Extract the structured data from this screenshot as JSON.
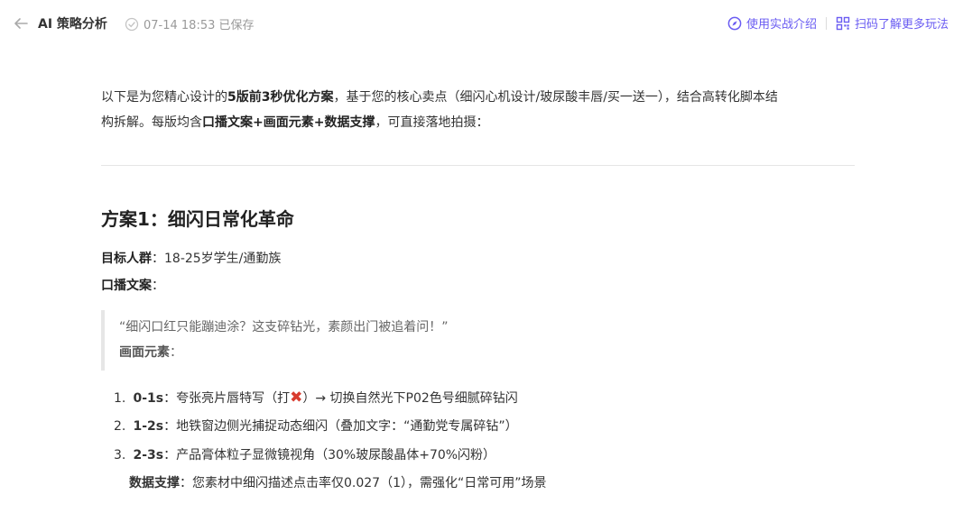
{
  "header": {
    "title": "AI 策略分析",
    "save_status": "07-14 18:53 已保存",
    "link_intro": "使用实战介绍",
    "link_scan": "扫码了解更多玩法",
    "accent_color": "#6a5cf2"
  },
  "intro": {
    "p1_a": "以下是为您精心设计的",
    "p1_b": "5版前3秒优化方案",
    "p1_c": "，基于您的核心卖点（细闪心机设计/玻尿酸丰唇/买一送一），结合高转化脚本结",
    "p2_a": "构拆解。每版均含",
    "p2_b": "口播文案+画面元素+数据支撑",
    "p2_c": "，可直接落地拍摄："
  },
  "plan1": {
    "heading": "方案1：细闪日常化革命",
    "audience_label": "目标人群",
    "audience_value": "：18-25岁学生/通勤族",
    "script_label": "口播文案",
    "script_colon": "：",
    "quote_text": "“细闪口红只能蹦迪涂？这支碎钻光，素颜出门被追着问！”",
    "elements_label": "画面元素",
    "elements_colon": "：",
    "steps": [
      {
        "num": "1.",
        "time": "0-1s",
        "text_a": "：夸张亮片唇特写（打",
        "icon": "cross-icon",
        "text_b": "）→ 切换自然光下P02色号细腻碎钻闪"
      },
      {
        "num": "2.",
        "time": "1-2s",
        "text_a": "：地铁窗边侧光捕捉动态细闪（叠加文字：“通勤党专属碎钻”）"
      },
      {
        "num": "3.",
        "time": "2-3s",
        "text_a": "：产品膏体粒子显微镜视角（30%玻尿酸晶体+70%闪粉）"
      }
    ],
    "data_label": "数据支撑",
    "data_value": "：您素材中细闪描述点击率仅0.027（1），需强化“日常可用”场景"
  }
}
